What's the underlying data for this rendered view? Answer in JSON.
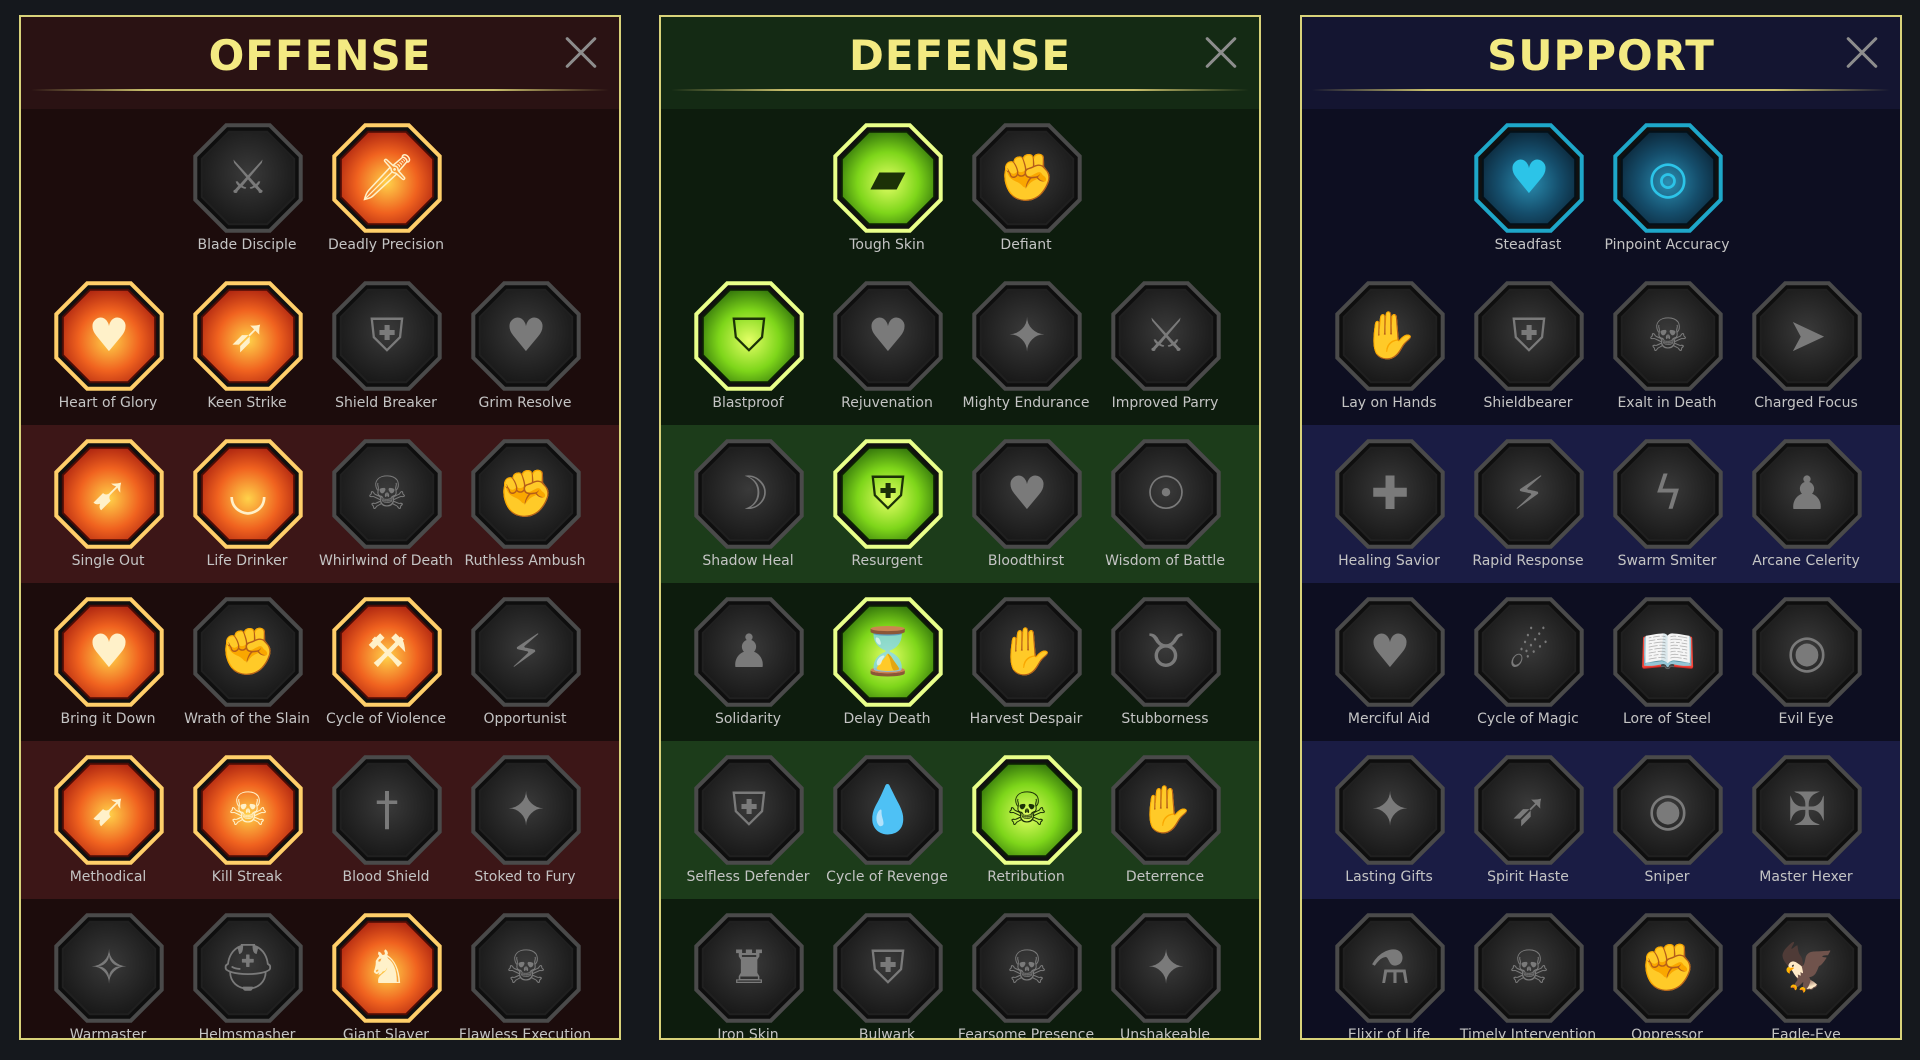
{
  "panels": [
    {
      "id": "offense",
      "title": "OFFENSE",
      "rows": [
        [
          {
            "label": "Blade Disciple",
            "state": "inactive",
            "icon": "crossed-swords-icon",
            "glyph": "⚔"
          },
          {
            "label": "Deadly Precision",
            "state": "active",
            "icon": "sword-slash-icon",
            "glyph": "🗡"
          }
        ],
        [
          {
            "label": "Heart of Glory",
            "state": "active",
            "icon": "horned-warrior-heart-icon",
            "glyph": "♥"
          },
          {
            "label": "Keen Strike",
            "state": "active",
            "icon": "spear-strike-icon",
            "glyph": "➶"
          },
          {
            "label": "Shield Breaker",
            "state": "inactive",
            "icon": "broken-shield-icon",
            "glyph": "⛨"
          },
          {
            "label": "Grim Resolve",
            "state": "inactive",
            "icon": "dark-heart-icon",
            "glyph": "♥"
          }
        ],
        [
          {
            "label": "Single Out",
            "state": "active",
            "icon": "arrows-target-icon",
            "glyph": "➹"
          },
          {
            "label": "Life Drinker",
            "state": "active",
            "icon": "fanged-mouth-icon",
            "glyph": "◡"
          },
          {
            "label": "Whirlwind of Death",
            "state": "inactive",
            "icon": "skull-whirlwind-icon",
            "glyph": "☠"
          },
          {
            "label": "Ruthless Ambush",
            "state": "inactive",
            "icon": "dagger-hand-icon",
            "glyph": "✊"
          }
        ],
        [
          {
            "label": "Bring it Down",
            "state": "active",
            "icon": "sword-heart-icon",
            "glyph": "♥"
          },
          {
            "label": "Wrath of the Slain",
            "state": "inactive",
            "icon": "fist-blade-icon",
            "glyph": "✊"
          },
          {
            "label": "Cycle of Violence",
            "state": "active",
            "icon": "axe-cycle-icon",
            "glyph": "⚒"
          },
          {
            "label": "Opportunist",
            "state": "inactive",
            "icon": "chain-lightning-icon",
            "glyph": "⚡"
          }
        ],
        [
          {
            "label": "Methodical",
            "state": "active",
            "icon": "arrow-volley-icon",
            "glyph": "➹"
          },
          {
            "label": "Kill Streak",
            "state": "active",
            "icon": "skulls-icon",
            "glyph": "☠"
          },
          {
            "label": "Blood Shield",
            "state": "inactive",
            "icon": "sword-shield-icon",
            "glyph": "†"
          },
          {
            "label": "Stoked to Fury",
            "state": "inactive",
            "icon": "raging-figure-icon",
            "glyph": "✦"
          }
        ],
        [
          {
            "label": "Warmaster",
            "state": "inactive",
            "icon": "sword-sparkles-icon",
            "glyph": "✧"
          },
          {
            "label": "Helmsmasher",
            "state": "inactive",
            "icon": "knight-helm-icon",
            "glyph": "⛑"
          },
          {
            "label": "Giant Slayer",
            "state": "active",
            "icon": "horned-giant-icon",
            "glyph": "♞"
          },
          {
            "label": "Flawless Execution",
            "state": "inactive",
            "icon": "crowned-skull-icon",
            "glyph": "☠"
          }
        ]
      ]
    },
    {
      "id": "defense",
      "title": "DEFENSE",
      "rows": [
        [
          {
            "label": "Tough Skin",
            "state": "active",
            "icon": "armor-plates-icon",
            "glyph": "▰"
          },
          {
            "label": "Defiant",
            "state": "inactive",
            "icon": "raised-fist-icon",
            "glyph": "✊"
          }
        ],
        [
          {
            "label": "Blastproof",
            "state": "active",
            "icon": "chevron-shield-icon",
            "glyph": "⛉"
          },
          {
            "label": "Rejuvenation",
            "state": "inactive",
            "icon": "anatomical-heart-icon",
            "glyph": "♥"
          },
          {
            "label": "Mighty Endurance",
            "state": "inactive",
            "icon": "strongman-icon",
            "glyph": "✦"
          },
          {
            "label": "Improved Parry",
            "state": "inactive",
            "icon": "crossed-blades-icon",
            "glyph": "⚔"
          }
        ],
        [
          {
            "label": "Shadow Heal",
            "state": "inactive",
            "icon": "shadow-figure-icon",
            "glyph": "☽"
          },
          {
            "label": "Resurgent",
            "state": "active",
            "icon": "knight-shield-icon",
            "glyph": "⛨"
          },
          {
            "label": "Bloodthirst",
            "state": "inactive",
            "icon": "skull-heart-icon",
            "glyph": "♥"
          },
          {
            "label": "Wisdom of Battle",
            "state": "inactive",
            "icon": "hooded-head-icon",
            "glyph": "☉"
          }
        ],
        [
          {
            "label": "Solidarity",
            "state": "inactive",
            "icon": "group-figures-icon",
            "glyph": "♟"
          },
          {
            "label": "Delay Death",
            "state": "active",
            "icon": "hourglass-icon",
            "glyph": "⌛"
          },
          {
            "label": "Harvest Despair",
            "state": "inactive",
            "icon": "open-hand-icon",
            "glyph": "✋"
          },
          {
            "label": "Stubborness",
            "state": "inactive",
            "icon": "bull-head-icon",
            "glyph": "♉"
          }
        ],
        [
          {
            "label": "Selfless Defender",
            "state": "inactive",
            "icon": "running-shield-icon",
            "glyph": "⛨"
          },
          {
            "label": "Cycle of Revenge",
            "state": "inactive",
            "icon": "blood-drops-icon",
            "glyph": "💧"
          },
          {
            "label": "Retribution",
            "state": "active",
            "icon": "radiant-skull-icon",
            "glyph": "☠"
          },
          {
            "label": "Deterrence",
            "state": "inactive",
            "icon": "deflect-hand-icon",
            "glyph": "✋"
          }
        ],
        [
          {
            "label": "Iron Skin",
            "state": "inactive",
            "icon": "armored-warrior-icon",
            "glyph": "♜"
          },
          {
            "label": "Bulwark",
            "state": "inactive",
            "icon": "winged-shield-icon",
            "glyph": "⛨"
          },
          {
            "label": "Fearsome Presence",
            "state": "inactive",
            "icon": "bearded-skull-icon",
            "glyph": "☠"
          },
          {
            "label": "Unshakeable",
            "state": "inactive",
            "icon": "flexing-figure-icon",
            "glyph": "✦"
          }
        ]
      ]
    },
    {
      "id": "support",
      "title": "SUPPORT",
      "rows": [
        [
          {
            "label": "Steadfast",
            "state": "active",
            "icon": "heart-plus-icon",
            "glyph": "♥"
          },
          {
            "label": "Pinpoint Accuracy",
            "state": "active",
            "icon": "target-swoosh-icon",
            "glyph": "◎"
          }
        ],
        [
          {
            "label": "Lay on Hands",
            "state": "inactive",
            "icon": "praying-hands-icon",
            "glyph": "✋"
          },
          {
            "label": "Shieldbearer",
            "state": "inactive",
            "icon": "shield-rings-icon",
            "glyph": "⛨"
          },
          {
            "label": "Exalt in Death",
            "state": "inactive",
            "icon": "flaming-skull-icon",
            "glyph": "☠"
          },
          {
            "label": "Charged Focus",
            "state": "inactive",
            "icon": "charging-hand-icon",
            "glyph": "➤"
          }
        ],
        [
          {
            "label": "Healing Savior",
            "state": "inactive",
            "icon": "healer-figure-icon",
            "glyph": "✚"
          },
          {
            "label": "Rapid Response",
            "state": "inactive",
            "icon": "lightning-bolt-icon",
            "glyph": "⚡"
          },
          {
            "label": "Swarm Smiter",
            "state": "inactive",
            "icon": "zigzag-icon",
            "glyph": "ϟ"
          },
          {
            "label": "Arcane Celerity",
            "state": "inactive",
            "icon": "shadow-runner-icon",
            "glyph": "♟"
          }
        ],
        [
          {
            "label": "Merciful Aid",
            "state": "inactive",
            "icon": "chained-heart-icon",
            "glyph": "♥"
          },
          {
            "label": "Cycle of Magic",
            "state": "inactive",
            "icon": "comet-icon",
            "glyph": "☄"
          },
          {
            "label": "Lore of Steel",
            "state": "inactive",
            "icon": "open-book-icon",
            "glyph": "📖"
          },
          {
            "label": "Evil Eye",
            "state": "inactive",
            "icon": "evil-eye-icon",
            "glyph": "◉"
          }
        ],
        [
          {
            "label": "Lasting Gifts",
            "state": "inactive",
            "icon": "compass-star-icon",
            "glyph": "✦"
          },
          {
            "label": "Spirit Haste",
            "state": "inactive",
            "icon": "winged-boot-icon",
            "glyph": "➶"
          },
          {
            "label": "Sniper",
            "state": "inactive",
            "icon": "eye-icon",
            "glyph": "◉"
          },
          {
            "label": "Master Hexer",
            "state": "inactive",
            "icon": "voodoo-doll-icon",
            "glyph": "✠"
          }
        ],
        [
          {
            "label": "Elixir of Life",
            "state": "inactive",
            "icon": "potion-flask-icon",
            "glyph": "⚗"
          },
          {
            "label": "Timely Intervention",
            "state": "inactive",
            "icon": "winged-skull-icon",
            "glyph": "☠"
          },
          {
            "label": "Oppressor",
            "state": "inactive",
            "icon": "crushing-fist-icon",
            "glyph": "✊"
          },
          {
            "label": "Eagle-Eye",
            "state": "inactive",
            "icon": "eagle-head-icon",
            "glyph": "🦅"
          }
        ]
      ]
    }
  ],
  "colors": {
    "title": "#f3ea82",
    "panel_border": "#d8d27a",
    "offense_active": "#e8542a",
    "defense_active": "#8fe01a",
    "support_active": "#1ea7c9",
    "inactive_icon": "#6a6a6a"
  }
}
